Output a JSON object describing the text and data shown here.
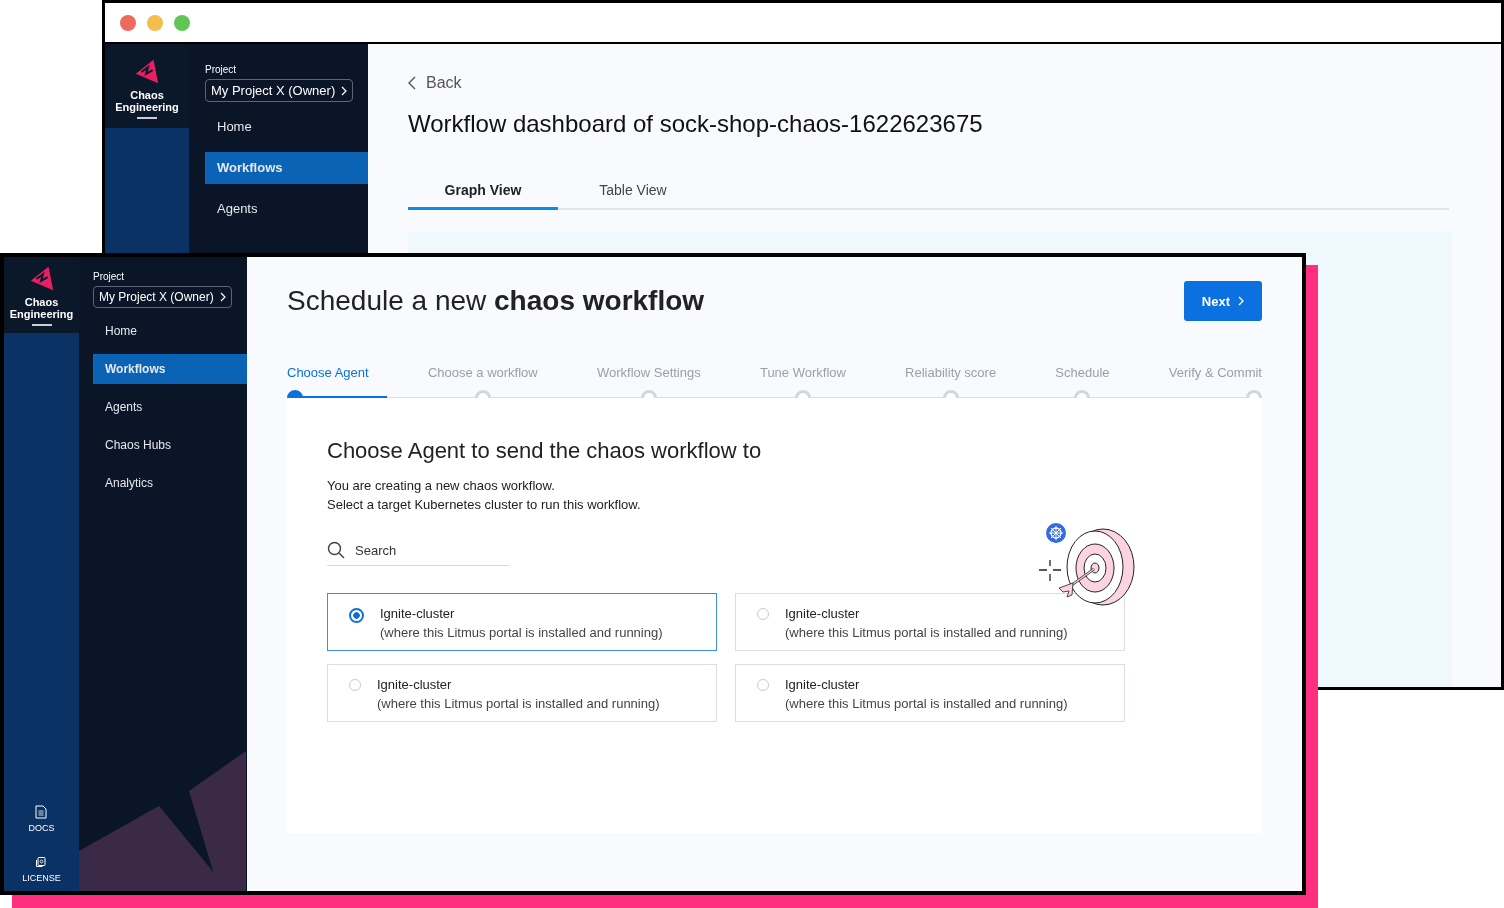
{
  "back_window": {
    "logo": "Chaos Engineering",
    "project_label": "Project",
    "project_selector": "My Project X (Owner)",
    "nav": [
      {
        "label": "Home",
        "selected": false
      },
      {
        "label": "Workflows",
        "selected": true
      },
      {
        "label": "Agents",
        "selected": false
      }
    ],
    "back_link": "Back",
    "title": "Workflow dashboard of sock-shop-chaos-1622623675",
    "tabs": [
      {
        "label": "Graph View",
        "selected": true
      },
      {
        "label": "Table View",
        "selected": false
      }
    ]
  },
  "front_window": {
    "logo": "Chaos Engineering",
    "project_label": "Project",
    "project_selector": "My Project X (Owner)",
    "nav": [
      {
        "label": "Home",
        "selected": false
      },
      {
        "label": "Workflows",
        "selected": true
      },
      {
        "label": "Agents",
        "selected": false
      },
      {
        "label": "Chaos Hubs",
        "selected": false
      },
      {
        "label": "Analytics",
        "selected": false
      }
    ],
    "bottom_links": [
      {
        "kind": "docs",
        "label": "DOCS"
      },
      {
        "kind": "license",
        "label": "LICENSE"
      }
    ],
    "title": "Schedule a new **chaos workflow**",
    "next_button": "Next",
    "stepper": {
      "level": 0.09
    },
    "steps": [
      {
        "label": "Choose Agent",
        "selected": true
      },
      {
        "label": "Choose a workflow",
        "selected": false
      },
      {
        "label": "Workflow Settings",
        "selected": false
      },
      {
        "label": "Tune Workflow",
        "selected": false
      },
      {
        "label": "Reliability score",
        "selected": false
      },
      {
        "label": "Schedule",
        "selected": false
      },
      {
        "label": "Verify & Commit",
        "selected": false
      }
    ],
    "heading": "Choose Agent to send the chaos workflow to",
    "description": [
      "You are creating a new chaos workflow.",
      "Select a target Kubernetes cluster to run this workflow."
    ],
    "search": {
      "placeholder": "Search"
    },
    "clusters": [
      {
        "name": "Ignite-cluster",
        "description": "(where this Litmus portal is installed and running)",
        "selected": true
      },
      {
        "name": "Ignite-cluster",
        "description": "(where this Litmus portal is installed and running)",
        "selected": false
      },
      {
        "name": "Ignite-cluster",
        "description": "(where this Litmus portal is installed and running)",
        "selected": false
      },
      {
        "name": "Ignite-cluster",
        "description": "(where this Litmus portal is installed and running)",
        "selected": false
      }
    ]
  }
}
